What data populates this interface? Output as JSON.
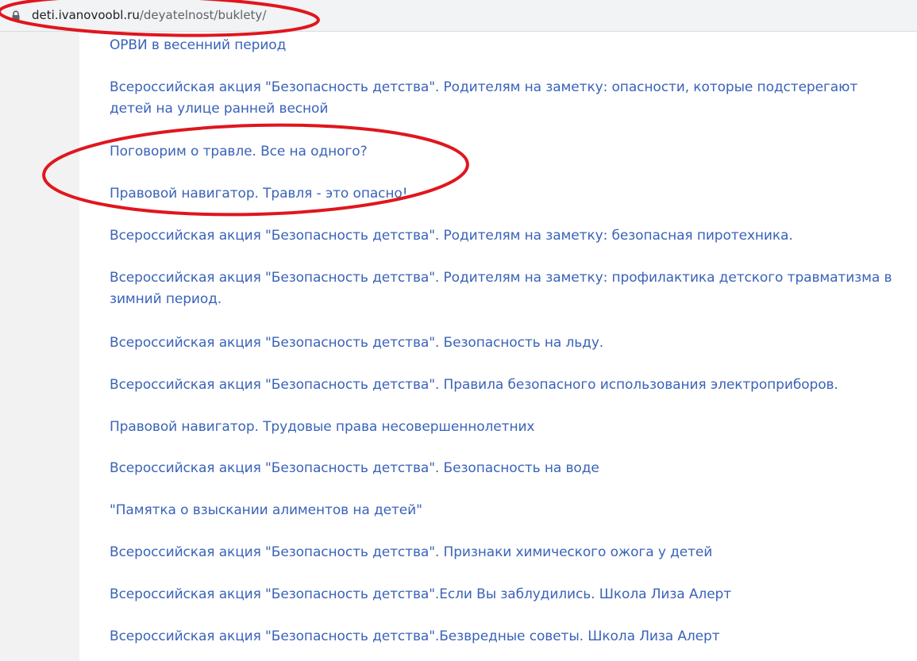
{
  "browser": {
    "url_host": "deti.ivanovoobl.ru",
    "url_path": "/deyatelnost/buklety/"
  },
  "links": [
    {
      "label": "ОРВИ в весенний период"
    },
    {
      "label": "Всероссийская акция \"Безопасность детства\". Родителям на заметку: опасности, которые подстерегают детей на улице ранней весной"
    },
    {
      "label": "Поговорим о травле. Все на одного?"
    },
    {
      "label": "Правовой навигатор. Травля - это опасно!"
    },
    {
      "label": "Всероссийская акция \"Безопасность детства\". Родителям на заметку: безопасная пиротехника."
    },
    {
      "label": "Всероссийская акция \"Безопасность детства\". Родителям на заметку: профилактика детского травматизма в зимний период."
    },
    {
      "label": "Всероссийская акция \"Безопасность детства\". Безопасность на льду."
    },
    {
      "label": "Всероссийская акция \"Безопасность детства\". Правила безопасного использования электроприборов."
    },
    {
      "label": "Правовой навигатор. Трудовые права несовершеннолетних"
    },
    {
      "label": "Всероссийская акция \"Безопасность детства\". Безопасность на воде"
    },
    {
      "label": "\"Памятка о взыскании алиментов на детей\""
    },
    {
      "label": "Всероссийская акция \"Безопасность детства\". Признаки химического ожога у детей"
    },
    {
      "label": "Всероссийская акция \"Безопасность детства\".Если Вы заблудились. Школа Лиза Алерт"
    },
    {
      "label": "Всероссийская акция \"Безопасность детства\".Безвредные советы. Школа Лиза Алерт"
    }
  ],
  "colors": {
    "link": "#3a63b8",
    "annotation": "#e0161e",
    "gutter": "#f2f2f2"
  },
  "icons": {
    "lock": "lock-icon"
  }
}
